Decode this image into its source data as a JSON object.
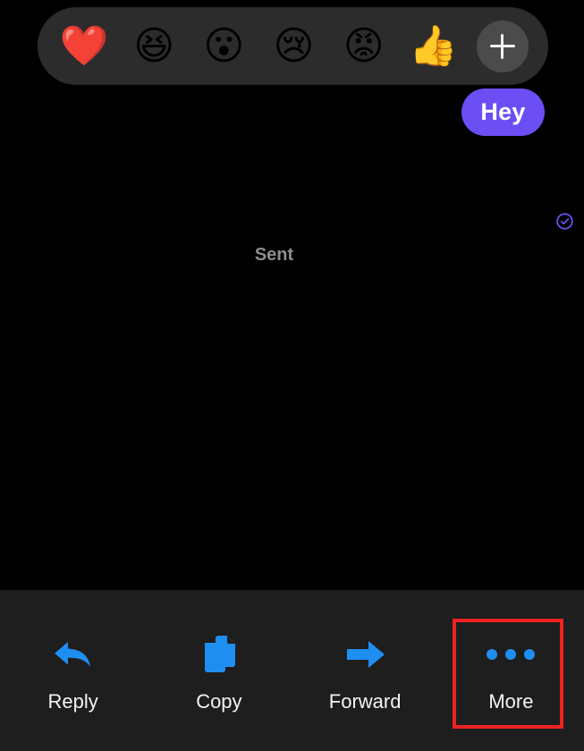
{
  "theme": {
    "page_background": "#000000",
    "reaction_bar_background": "#2c2c2c",
    "bubble_color": "#6C4EF5",
    "action_bar_background": "#1e1e1e",
    "icon_accent": "#1f8ef1",
    "highlight_color": "#ef2222",
    "status_text_color": "#8d8d8d"
  },
  "reaction_bar": {
    "name": "message-reaction-picker",
    "items": [
      {
        "icon": "heart-emoji",
        "glyph": "❤️",
        "label": "Love"
      },
      {
        "icon": "laughing-emoji",
        "glyph": "😆",
        "label": "Haha"
      },
      {
        "icon": "surprised-emoji",
        "glyph": "😮",
        "label": "Wow"
      },
      {
        "icon": "sad-emoji",
        "glyph": "😢",
        "label": "Sad"
      },
      {
        "icon": "angry-emoji",
        "glyph": "😡",
        "label": "Angry"
      },
      {
        "icon": "thumbs-up-emoji",
        "glyph": "👍",
        "label": "Like"
      }
    ],
    "add_button": {
      "icon": "plus-icon",
      "label": "+"
    }
  },
  "conversation": {
    "message": {
      "text": "Hey",
      "direction": "outgoing"
    },
    "status": {
      "label": "Sent",
      "icon": "check-circle-icon"
    }
  },
  "action_bar": {
    "items": [
      {
        "icon": "reply-arrow-icon",
        "label": "Reply",
        "highlighted": false
      },
      {
        "icon": "copy-icon",
        "label": "Copy",
        "highlighted": false
      },
      {
        "icon": "forward-arrow-icon",
        "label": "Forward",
        "highlighted": false
      },
      {
        "icon": "more-dots-icon",
        "label": "More",
        "highlighted": true
      }
    ]
  }
}
